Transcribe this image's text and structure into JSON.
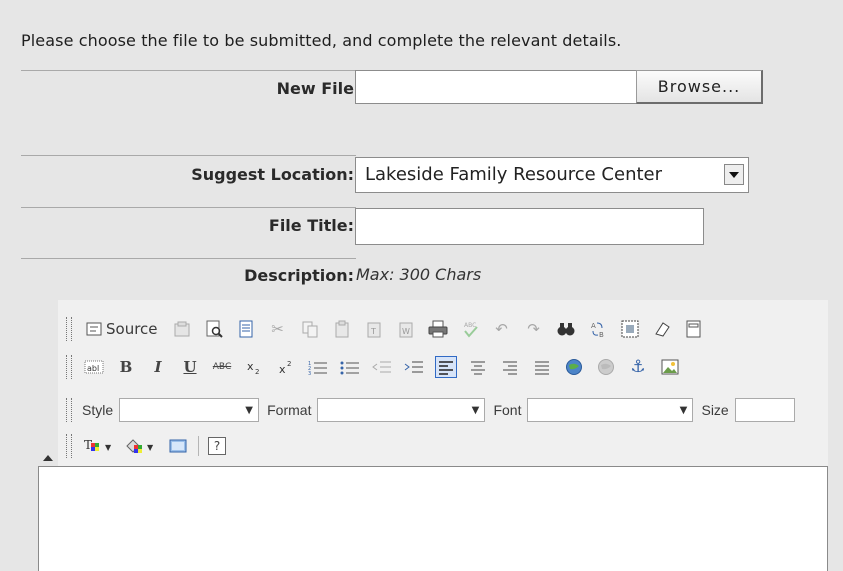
{
  "intro_text": "Please choose the file to be submitted, and complete the relevant details.",
  "new_file": {
    "label": "New File",
    "value": "",
    "browse_label": "Browse..."
  },
  "location": {
    "label": "Suggest Location:",
    "selected": "Lakeside Family Resource Center"
  },
  "file_title": {
    "label": "File Title:",
    "value": ""
  },
  "description": {
    "label": "Description:",
    "hint": "Max: 300 Chars"
  },
  "editor": {
    "source_label": "Source",
    "style_label": "Style",
    "format_label": "Format",
    "font_label": "Font",
    "size_label": "Size",
    "bold_glyph": "B",
    "italic_glyph": "I",
    "underline_glyph": "U",
    "strike_glyph": "ABC",
    "help_glyph": "?",
    "content": ""
  }
}
